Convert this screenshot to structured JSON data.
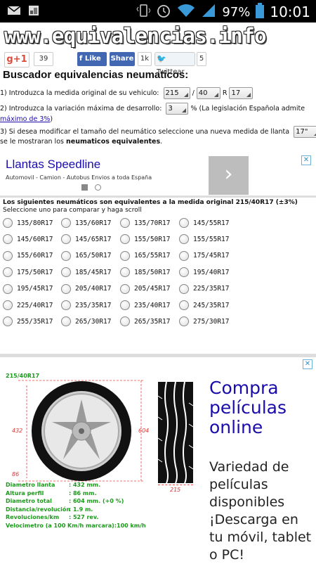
{
  "status_bar": {
    "battery_pct": "97%",
    "time": "10:01",
    "icons": [
      "mail-icon",
      "image-icon",
      "vibrate-icon",
      "alarm-icon",
      "wifi-icon",
      "signal-icon",
      "battery-icon"
    ]
  },
  "site": {
    "title": "www.equivalencias.info"
  },
  "social": {
    "gplus_label": "g+1",
    "gplus_count": "39",
    "fb_like": "Like",
    "fb_share": "Share",
    "fb_count": "1k",
    "tw_label": "Twittear",
    "tw_count": "5"
  },
  "heading": "Buscador equivalencias neumaticos:",
  "form": {
    "step1_label": "1) Introduzca la medida original de su vehiculo:",
    "width_value": "215",
    "slash": "/",
    "profile_value": "40",
    "r_label": "R",
    "rim_value": "17",
    "step2_label": "2) Introduzca la variación máxima de desarrollo:",
    "variation_value": "3",
    "step2_suffix": "% (La legislación Española admite",
    "step2_link": "máximo de 3%",
    "step2_close": ")",
    "step3_label": "3) Si desea modificar el tamaño del neumático seleccione una nueva medida de llanta",
    "new_rim_value": "17\"",
    "step3_y": "y",
    "step3_line2_a": "se le mostraran los ",
    "step3_line2_bold": "neumaticos equivalentes",
    "step3_line2_c": "."
  },
  "ad1": {
    "title": "Llantas Speedline",
    "subtitle": "Automovil - Camion - Autobus Envios a toda España",
    "arrow": "›",
    "close": "✕"
  },
  "equivalents": {
    "heading": "Los siguientes neumáticos son equivalentes a la medida original 215/40R17 (±3%)",
    "sub": "Seleccione uno para comparar y haga scroll",
    "options": [
      "135/80R17",
      "135/60R17",
      "135/70R17",
      "145/55R17",
      "145/60R17",
      "145/65R17",
      "155/50R17",
      "155/55R17",
      "155/60R17",
      "165/50R17",
      "165/55R17",
      "175/45R17",
      "175/50R17",
      "185/45R17",
      "185/50R17",
      "195/40R17",
      "195/45R17",
      "205/40R17",
      "205/45R17",
      "225/35R17",
      "225/40R17",
      "235/35R17",
      "235/40R17",
      "245/35R17",
      "255/35R17",
      "265/30R17",
      "265/35R17",
      "275/30R17"
    ]
  },
  "tire_diagram": {
    "size_label": "215/40R17",
    "dim_rim": "432",
    "dim_total": "604",
    "dim_profile": "86",
    "dim_width": "215"
  },
  "specs": [
    {
      "k": "Diametro llanta",
      "v": ": 432 mm."
    },
    {
      "k": "Altura perfil",
      "v": ": 86 mm."
    },
    {
      "k": "Diametro total",
      "v": ": 604 mm. (+0 %)"
    },
    {
      "k": "Distancia/revolución",
      "v": ": 1.9 m."
    },
    {
      "k": "Revoluciones/km",
      "v": ": 527 rev."
    },
    {
      "k": "Velocimetro (a 100 Km/h marcara)",
      "v": ":100 km/h"
    }
  ],
  "ad2": {
    "title": "Compra películas online",
    "body": "Variedad de películas disponibles ¡Descarga en tu móvil, tablet o PC!",
    "close": "✕"
  }
}
